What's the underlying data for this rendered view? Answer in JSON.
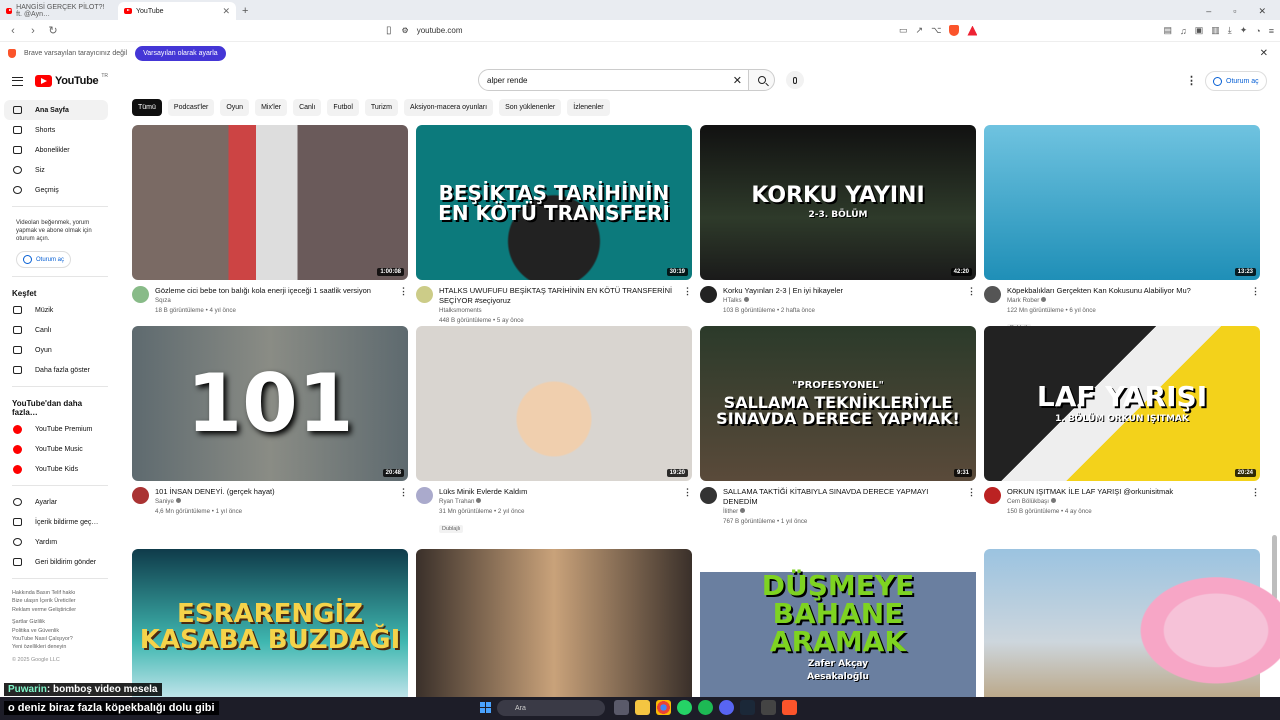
{
  "browser": {
    "tabs": [
      {
        "label": "HANGİSİ GERÇEK PİLOT?! ft. @Ayn…",
        "active": false
      },
      {
        "label": "YouTube",
        "active": true
      }
    ],
    "url": "youtube.com",
    "infobar_text": "Brave varsayılan tarayıcınız değil",
    "infobar_button": "Varsayılan olarak ayarla"
  },
  "header": {
    "logo_text": "YouTube",
    "logo_region": "TR",
    "search_value": "alper rende",
    "signin_label": "Oturum aç"
  },
  "chips": [
    "Tümü",
    "Podcast'ler",
    "Oyun",
    "Mix'ler",
    "Canlı",
    "Futbol",
    "Turizm",
    "Aksiyon-macera oyunları",
    "Son yüklenenler",
    "İzlenenler"
  ],
  "sidebar": {
    "main": [
      {
        "label": "Ana Sayfa",
        "icon": "home-icon"
      },
      {
        "label": "Shorts",
        "icon": "shorts-icon"
      },
      {
        "label": "Abonelikler",
        "icon": "subscriptions-icon"
      },
      {
        "label": "Siz",
        "icon": "you-icon"
      },
      {
        "label": "Geçmiş",
        "icon": "history-icon"
      }
    ],
    "note": "Videoları beğenmek, yorum yapmak ve abone olmak için oturum açın.",
    "signin": "Oturum aç",
    "explore_title": "Keşfet",
    "explore": [
      {
        "label": "Müzik",
        "icon": "music-icon"
      },
      {
        "label": "Canlı",
        "icon": "live-icon"
      },
      {
        "label": "Oyun",
        "icon": "gaming-icon"
      },
      {
        "label": "Daha fazla göster",
        "icon": "chevron-down-icon"
      }
    ],
    "more_title": "YouTube'dan daha fazla…",
    "more": [
      {
        "label": "YouTube Premium"
      },
      {
        "label": "YouTube Music"
      },
      {
        "label": "YouTube Kids"
      }
    ],
    "settings": [
      {
        "label": "Ayarlar",
        "icon": "gear-icon"
      },
      {
        "label": "İçerik bildirme geç…",
        "icon": "flag-icon"
      },
      {
        "label": "Yardım",
        "icon": "help-icon"
      },
      {
        "label": "Geri bildirim gönder",
        "icon": "feedback-icon"
      }
    ],
    "links1": "Hakkında  Basın  Telif hakkı",
    "links2": "Bize ulaşın  İçerik Üreticiler",
    "links3": "Reklam verme  Geliştiriciler",
    "links4": "Şartlar  Gizlilik",
    "links5": "Politika ve Güvenlik",
    "links6": "YouTube Nasıl Çalışıyor?",
    "links7": "Yeni özellikleri deneyin",
    "copyright": "© 2025 Google LLC"
  },
  "videos": [
    {
      "title": "Gözleme cici bebe ton balığı kola enerji içeceği 1 saatlik versiyon",
      "channel": "Sqıza",
      "stats": "18 B görüntüleme • 4 yıl önce",
      "duration": "1:00:08",
      "thumb_text": "",
      "verified": false,
      "badge": ""
    },
    {
      "title": "HTALKS UWUFUFU BEŞİKTAŞ TARİHİNİN EN KÖTÜ TRANSFERİNİ SEÇİYOR  #seçiyoruz",
      "channel": "Htalksmoments",
      "stats": "448 B görüntüleme • 5 ay önce",
      "duration": "30:19",
      "thumb_text": "BEŞİKTAŞ TARİHİNİN EN KÖTÜ TRANSFERİ",
      "verified": false,
      "badge": ""
    },
    {
      "title": "Korku Yayınları 2-3 | En iyi hikayeler",
      "channel": "HTalks",
      "stats": "103 B görüntüleme • 2 hafta önce",
      "duration": "42:20",
      "thumb_text": "KORKU YAYINI",
      "thumb_sub": "2-3. BÖLÜM",
      "verified": true,
      "badge": ""
    },
    {
      "title": "Köpekbalıkları Gerçekten Kan Kokusunu Alabiliyor Mu?",
      "channel": "Mark Rober",
      "stats": "122 Mn görüntüleme • 6 yıl önce",
      "duration": "13:23",
      "thumb_text": "",
      "verified": true,
      "badge": "Dublajlı"
    },
    {
      "title": "101 İNSAN DENEYİ. (gerçek hayat)",
      "channel": "Saniye",
      "stats": "4,6 Mn görüntüleme • 1 yıl önce",
      "duration": "20:48",
      "thumb_text": "101",
      "verified": true,
      "badge": ""
    },
    {
      "title": "Lüks Minik Evlerde Kaldım",
      "channel": "Ryan Trahan",
      "stats": "31 Mn görüntüleme • 2 yıl önce",
      "duration": "19:20",
      "thumb_text": "",
      "verified": true,
      "badge": "Dublajlı"
    },
    {
      "title": "SALLAMA TAKTİĞİ KİTABIYLA SINAVDA DERECE YAPMAYI DENEDİM",
      "channel": "İlither",
      "stats": "767 B görüntüleme • 1 yıl önce",
      "duration": "9:31",
      "thumb_text": "SALLAMA TEKNİKLERİYLE SINAVDA DERECE YAPMAK!",
      "thumb_sub": "\"PROFESYONEL\"",
      "verified": true,
      "badge": ""
    },
    {
      "title": "ORKUN IŞITMAK İLE LAF YARIŞI @orkunisitmak",
      "channel": "Cem Bölükbaşı",
      "stats": "150 B görüntüleme • 4 ay önce",
      "duration": "20:24",
      "thumb_text": "LAF YARIŞI",
      "thumb_sub": "1. BÖLÜM ORKUN IŞITMAK",
      "verified": true,
      "badge": ""
    },
    {
      "title": "",
      "channel": "",
      "stats": "",
      "duration": "",
      "thumb_text": "ESRARENGİZ KASABA BUZDAĞI",
      "verified": false,
      "badge": ""
    },
    {
      "title": "",
      "channel": "",
      "stats": "",
      "duration": "",
      "thumb_text": "",
      "verified": false,
      "badge": ""
    },
    {
      "title": "",
      "channel": "",
      "stats": "",
      "duration": "",
      "thumb_text": "DÜŞMEYE BAHANE ARAMAK",
      "thumb_sub": "Zafer Akçay",
      "thumb_sub2": "Aesakaloğlu",
      "verified": false,
      "badge": ""
    },
    {
      "title": "",
      "channel": "",
      "stats": "",
      "duration": "",
      "thumb_text": "",
      "verified": false,
      "badge": ""
    }
  ],
  "overlay": {
    "chat_user": "Puwarin",
    "chat_text": ": bomboş video mesela",
    "caption": "o deniz biraz fazla köpekbalığı dolu gibi"
  },
  "taskbar": {
    "search": "Ara"
  },
  "colors": {
    "accent": "#065fd4",
    "brand_red": "#ff0000",
    "brave_button": "#4436d6"
  }
}
